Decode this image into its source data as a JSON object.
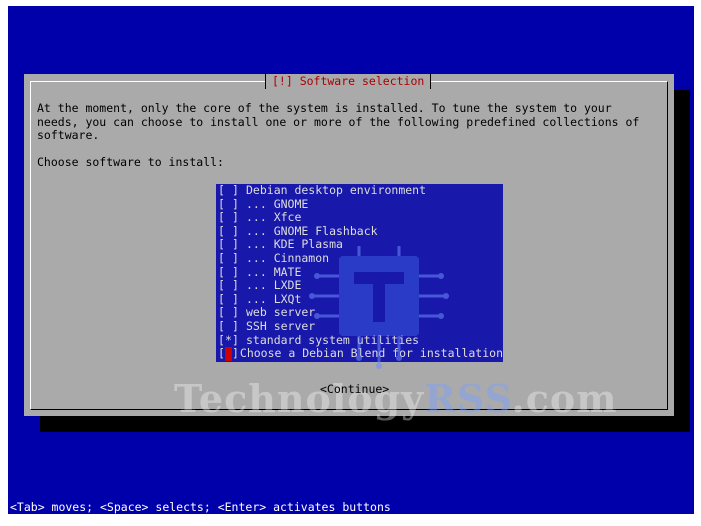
{
  "dialog": {
    "title": "[!] Software selection",
    "intro": "At the moment, only the core of the system is installed. To tune the system to your\nneeds, you can choose to install one or more of the following predefined collections of\nsoftware.",
    "prompt": "Choose software to install:",
    "items": [
      {
        "mark": " ",
        "label": "Debian desktop environment",
        "checked": false
      },
      {
        "mark": " ",
        "label": "... GNOME",
        "checked": false
      },
      {
        "mark": " ",
        "label": "... Xfce",
        "checked": false
      },
      {
        "mark": " ",
        "label": "... GNOME Flashback",
        "checked": false
      },
      {
        "mark": " ",
        "label": "... KDE Plasma",
        "checked": false
      },
      {
        "mark": " ",
        "label": "... Cinnamon",
        "checked": false
      },
      {
        "mark": " ",
        "label": "... MATE",
        "checked": false
      },
      {
        "mark": " ",
        "label": "... LXDE",
        "checked": false
      },
      {
        "mark": " ",
        "label": "... LXQt",
        "checked": false
      },
      {
        "mark": " ",
        "label": "web server",
        "checked": false
      },
      {
        "mark": " ",
        "label": "SSH server",
        "checked": false
      },
      {
        "mark": "*",
        "label": "standard system utilities",
        "checked": true
      },
      {
        "mark": " ",
        "label": "Choose a Debian Blend for installation",
        "checked": false,
        "focused": true
      }
    ],
    "continue_label": "<Continue>"
  },
  "watermark": {
    "text_main": "Technology",
    "text_accent": "RSS",
    "text_suffix": ".com"
  },
  "status_bar": {
    "text": "<Tab> moves; <Space> selects; <Enter> activates buttons"
  },
  "colors": {
    "screen_bg": "#0000aa",
    "dialog_bg": "#aaaaaa",
    "title_text": "#aa0000",
    "list_bg": "#1818aa",
    "focus_marker": "#cc0000"
  }
}
